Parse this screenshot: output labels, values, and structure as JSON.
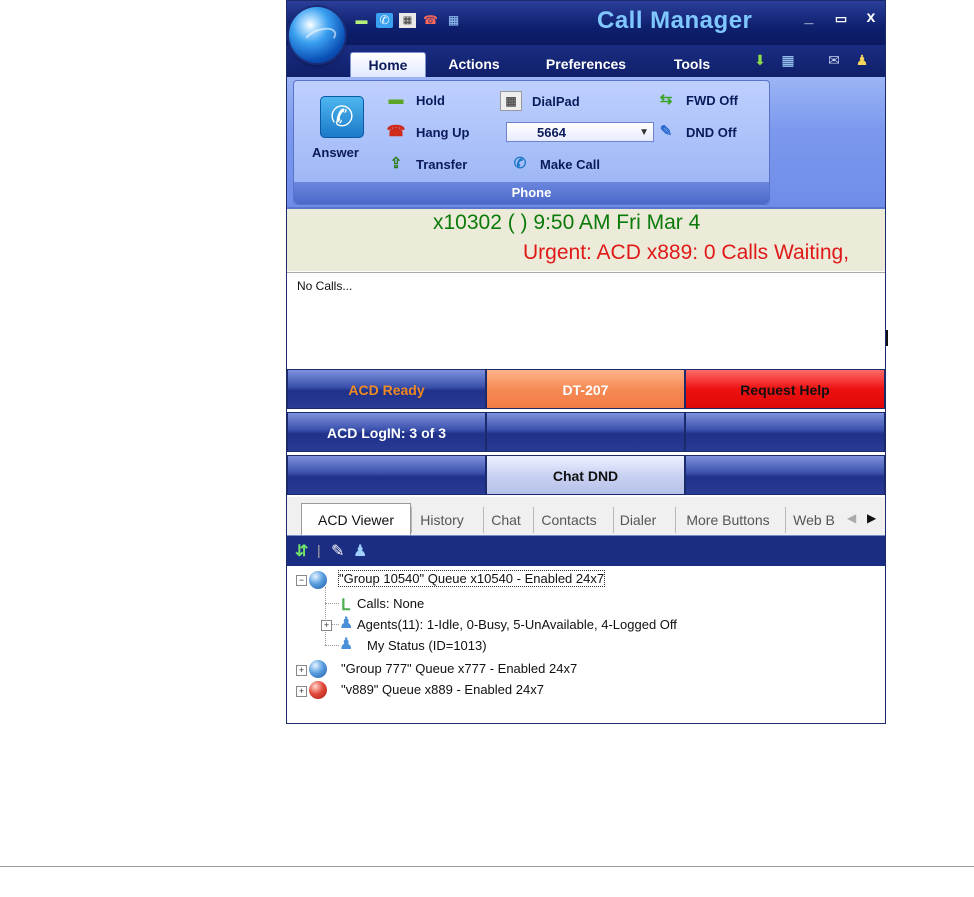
{
  "window": {
    "title": "Call Manager",
    "controls": {
      "minimize": "_",
      "maximize": "▭",
      "close": "x"
    }
  },
  "quick_access": [
    "hold-icon",
    "answer-icon",
    "dialpad-icon",
    "hangup-icon",
    "grid-icon"
  ],
  "ribbon_tabs": [
    {
      "label": "Home",
      "active": true
    },
    {
      "label": "Actions"
    },
    {
      "label": "Preferences"
    },
    {
      "label": "Tools"
    }
  ],
  "ribbon_tab_icons": [
    "download-icon",
    "grid-icon",
    "mail-icon",
    "user-icon"
  ],
  "phone_group": {
    "label": "Phone",
    "answer": "Answer",
    "hold": "Hold",
    "hang_up": "Hang Up",
    "transfer": "Transfer",
    "dialpad": "DialPad",
    "combo_value": "5664",
    "make_call": "Make Call",
    "fwd": "FWD Off",
    "dnd": "DND Off"
  },
  "status": {
    "line": "x10302 ( )  9:50 AM Fri Mar 4",
    "alert": "Urgent: ACD x889: 0 Calls Waiting,"
  },
  "calls": {
    "text": "No Calls..."
  },
  "buttons": [
    [
      "ACD Ready",
      "DT-207",
      "Request Help"
    ],
    [
      "ACD LogIN: 3 of 3",
      "",
      ""
    ],
    [
      "",
      "Chat DND",
      ""
    ]
  ],
  "colors": {
    "acd_ready": "#f08a22",
    "dt_button": "#f58a55",
    "request_help": "#ee1111",
    "status_green": "#0a7a0a",
    "status_red": "#e01919"
  },
  "bottom_tabs": [
    {
      "label": "ACD Viewer",
      "active": true
    },
    {
      "label": "History"
    },
    {
      "label": "Chat"
    },
    {
      "label": "Contacts"
    },
    {
      "label": "Dialer"
    },
    {
      "label": "More Buttons"
    },
    {
      "label": "Web B"
    }
  ],
  "viewer_toolbar": [
    "expand-icon",
    "settings-icon",
    "agents-icon"
  ],
  "tree": {
    "group1": "\"Group 10540\" Queue x10540 - Enabled 24x7",
    "calls": "Calls:  None",
    "agents": "Agents(11): 1-Idle, 0-Busy, 5-UnAvailable, 4-Logged  Off",
    "my_status": "My Status (ID=1013)",
    "group2": "\"Group 777\" Queue x777 - Enabled 24x7",
    "group3": "\"v889\" Queue x889 - Enabled 24x7"
  }
}
